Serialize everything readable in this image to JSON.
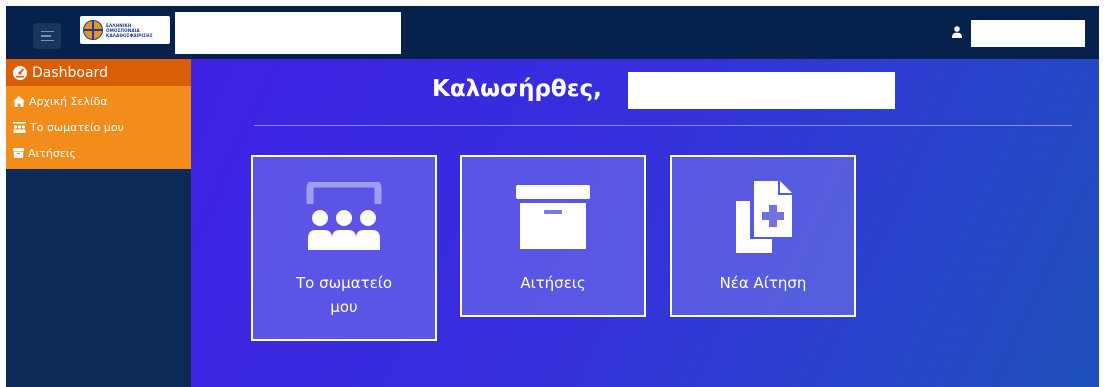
{
  "sidebar": {
    "header": "Dashboard",
    "items": [
      {
        "label": "Αρχική Σελίδα",
        "icon": "home-icon"
      },
      {
        "label": "Το σωματείο μου",
        "icon": "team-icon"
      },
      {
        "label": "Αιτήσεις",
        "icon": "archive-icon"
      }
    ]
  },
  "logo": {
    "line1": "ΕΛΛΗΝΙΚΗ",
    "line2": "ΟΜΟΣΠΟΝΔΙΑ",
    "line3": "ΚΑΛΑΘΟΣΦΑΙΡΙΣΗΣ"
  },
  "main": {
    "welcome": "Καλωσήρθες,",
    "cards": [
      {
        "label": "Το σωματείο μου",
        "icon": "people-board-icon"
      },
      {
        "label": "Αιτήσεις",
        "icon": "archive-box-icon"
      },
      {
        "label": "Νέα Αίτηση",
        "icon": "new-document-icon"
      }
    ]
  },
  "colors": {
    "topbar": "#06214b",
    "sidebar": "#0b2a57",
    "sidebar_header": "#d85f06",
    "sidebar_items": "#f28c1a",
    "main_gradient_start": "#3f22e6",
    "main_gradient_end": "#1e50b8"
  }
}
